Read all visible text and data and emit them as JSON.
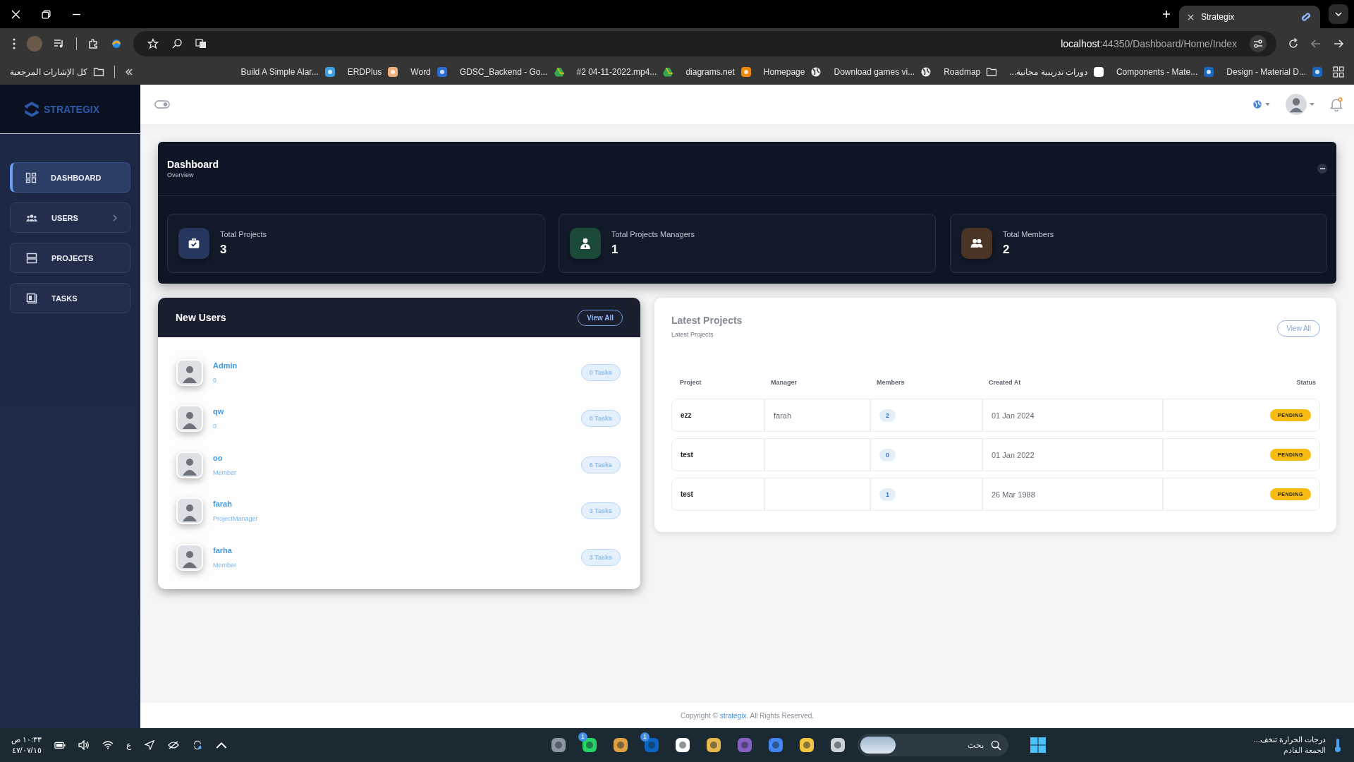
{
  "browser": {
    "tab": {
      "title": "Strategix",
      "selected": true
    },
    "url_host": "localhost",
    "url_path": ":44350/Dashboard/Home/Index",
    "all_bookmarks": "كل الإشارات المرجعية",
    "bookmarks": [
      {
        "label": "Build A Simple Alar...",
        "kind": "cn"
      },
      {
        "label": "ERDPlus",
        "kind": "er"
      },
      {
        "label": "Word",
        "kind": "word"
      },
      {
        "label": "GDSC_Backend - Go...",
        "kind": "drive"
      },
      {
        "label": "#2 04-11-2022.mp4...",
        "kind": "drive"
      },
      {
        "label": "diagrams.net",
        "kind": "diagrams"
      },
      {
        "label": "Homepage",
        "kind": "globe"
      },
      {
        "label": "Download games vi...",
        "kind": "globe"
      },
      {
        "label": "Roadmap",
        "kind": "folder"
      },
      {
        "label": "دورات تدريبية مجانية...",
        "kind": "google"
      },
      {
        "label": "Components - Mate...",
        "kind": "vuetify"
      },
      {
        "label": "Design - Material D...",
        "kind": "vuetify"
      }
    ]
  },
  "sidebar": {
    "brand": "STRATEGIX",
    "items": [
      {
        "label": "DASHBOARD",
        "kind": "dashboard",
        "selected": true,
        "expandable": false
      },
      {
        "label": "USERS",
        "kind": "users",
        "selected": false,
        "expandable": true
      },
      {
        "label": "PROJECTS",
        "kind": "projects",
        "selected": false,
        "expandable": false
      },
      {
        "label": "TASKS",
        "kind": "tasks",
        "selected": false,
        "expandable": false
      }
    ]
  },
  "dashboard": {
    "title": "Dashboard",
    "subtitle": "Overview",
    "stats": [
      {
        "label": "Total Projects",
        "value": "3",
        "kind": "briefcase",
        "color": "#26365e"
      },
      {
        "label": "Total Projects Managers",
        "value": "1",
        "kind": "manager",
        "color": "#1c4a38"
      },
      {
        "label": "Total Members",
        "value": "2",
        "kind": "members",
        "color": "#4a3426"
      }
    ]
  },
  "new_users": {
    "title": "New Users",
    "view_all": "View All",
    "users": [
      {
        "name": "Admin",
        "role": "0",
        "tasks": "0 Tasks"
      },
      {
        "name": "qw",
        "role": "0",
        "tasks": "0 Tasks"
      },
      {
        "name": "oo",
        "role": "Member",
        "tasks": "6 Tasks"
      },
      {
        "name": "farah",
        "role": "ProjectManager",
        "tasks": "3 Tasks"
      },
      {
        "name": "farha",
        "role": "Member",
        "tasks": "3 Tasks"
      }
    ]
  },
  "latest_projects": {
    "title": "Latest Projects",
    "subtitle": "Latest Projects",
    "view_all": "View All",
    "columns": [
      "Project",
      "Manager",
      "Members",
      "Created At",
      "Status"
    ],
    "rows": [
      {
        "project": "ezz",
        "manager": "farah",
        "members": "2",
        "created_at": "01 Jan 2024",
        "status": "PENDING"
      },
      {
        "project": "test",
        "members": "0",
        "created_at": "01 Jan 2022",
        "status": "PENDING"
      },
      {
        "project": "test",
        "members": "1",
        "created_at": "26 Mar 1988",
        "status": "PENDING"
      }
    ]
  },
  "footer": {
    "prefix": "Copyright © ",
    "link": "strategix",
    "suffix": ". All Rights Reserved."
  },
  "taskbar": {
    "time": "١٠:٣٣ ص",
    "date": "٤٧/٠٧/١٥",
    "language": "ع",
    "search_placeholder": "بحث",
    "apps": [
      {
        "kind": "settings"
      },
      {
        "kind": "whatsapp",
        "badge": "1"
      },
      {
        "kind": "chrome-profile"
      },
      {
        "kind": "linkedin",
        "badge": "1"
      },
      {
        "kind": "notion"
      },
      {
        "kind": "snip"
      },
      {
        "kind": "vs"
      },
      {
        "kind": "chrome"
      },
      {
        "kind": "files"
      },
      {
        "kind": "window"
      }
    ],
    "weather_title": "درجات الحرارة تنخف...",
    "weather_subtitle": "الجمعة القادم"
  }
}
